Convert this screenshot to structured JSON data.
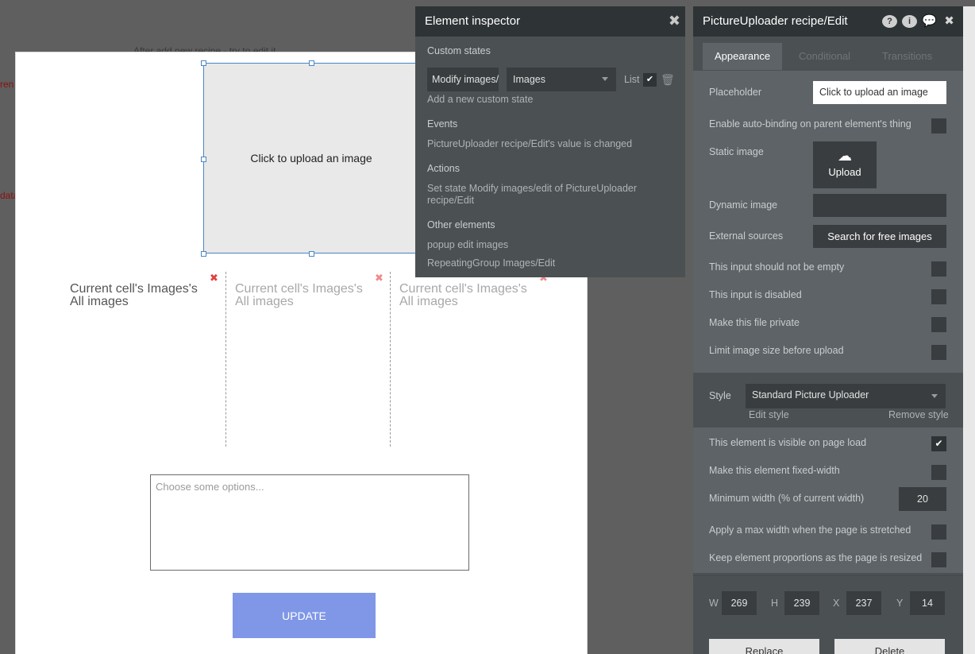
{
  "background": {
    "top_text": "After add new recipe - try to edit it",
    "red_text_1": "ren",
    "red_text_2": "data"
  },
  "canvas": {
    "uploader_placeholder": "Click to upload an image",
    "cells": [
      {
        "text": "Current cell's Images's All images",
        "active": true
      },
      {
        "text": "Current cell's Images's All images",
        "active": false
      },
      {
        "text": "Current cell's Images's All images",
        "active": false
      }
    ],
    "delete_glyph": "✖",
    "multi_placeholder": "Choose some options...",
    "update_label": "UPDATE"
  },
  "inspector": {
    "title": "Element inspector",
    "close_glyph": "✖",
    "custom_states_label": "Custom states",
    "state_name": "Modify images/edit",
    "state_type": "Images",
    "list_label": "List",
    "list_checked": true,
    "add_state_link": "Add a new custom state",
    "events_label": "Events",
    "event_item": "PictureUploader recipe/Edit's value is changed",
    "actions_label": "Actions",
    "action_item": "Set state Modify images/edit of PictureUploader recipe/Edit",
    "other_label": "Other elements",
    "other_items": [
      "popup edit images",
      "RepeatingGroup Images/Edit"
    ]
  },
  "properties": {
    "title": "PictureUploader recipe/Edit",
    "icons": [
      "help-icon",
      "info-icon",
      "comment-icon",
      "close-icon"
    ],
    "tabs": [
      "Appearance",
      "Conditional",
      "Transitions"
    ],
    "active_tab": "Appearance",
    "placeholder_label": "Placeholder",
    "placeholder_value": "Click to upload an image",
    "autobinding_label": "Enable auto-binding on parent element's thing",
    "static_image_label": "Static image",
    "upload_label": "Upload",
    "dynamic_image_label": "Dynamic image",
    "external_sources_label": "External sources",
    "search_free_images": "Search for free images",
    "not_empty_label": "This input should not be empty",
    "disabled_label": "This input is disabled",
    "private_label": "Make this file private",
    "limit_size_label": "Limit image size before upload",
    "style_label": "Style",
    "style_value": "Standard Picture Uploader",
    "edit_style": "Edit style",
    "remove_style": "Remove style",
    "visible_label": "This element is visible on page load",
    "visible_checked": true,
    "fixed_width_label": "Make this element fixed-width",
    "min_width_label": "Minimum width (% of current width)",
    "min_width_value": "20",
    "max_width_label": "Apply a max width when the page is stretched",
    "keep_props_label": "Keep element proportions as the page is resized",
    "w_label": "W",
    "w_value": "269",
    "h_label": "H",
    "h_value": "239",
    "x_label": "X",
    "x_value": "237",
    "y_label": "Y",
    "y_value": "14",
    "replace_label": "Replace",
    "delete_label": "Delete"
  }
}
